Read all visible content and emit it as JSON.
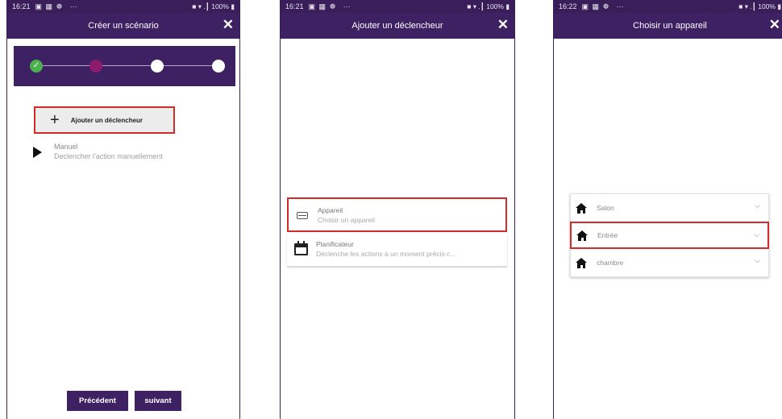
{
  "status_bar": {
    "icons": "▣ ▦ ☸",
    "dots": "···",
    "right": "■ ▾ .┃ 100% ▮",
    "times": [
      "16:21",
      "16:21",
      "16:22"
    ]
  },
  "panel1": {
    "title": "Créer un scénario",
    "close": "✕",
    "steps_done_mark": "✓",
    "add_trigger_label": "Ajouter un déclencheur",
    "add_trigger_plus": "+",
    "manual_title": "Manuel",
    "manual_subtitle": "Declencher l'action manuellement",
    "btn_prev": "Précédent",
    "btn_next": "suivant"
  },
  "panel2": {
    "title": "Ajouter un déclencheur",
    "close": "✕",
    "options": [
      {
        "title": "Appareil",
        "subtitle": "Choisir un appareil"
      },
      {
        "title": "Planificateur",
        "subtitle": "Déclenche les actions à un moment précis c..."
      }
    ]
  },
  "panel3": {
    "title": "Choisir un appareil",
    "close": "✕",
    "rooms": [
      "Salon",
      "Entrée",
      "chambre"
    ],
    "chevron": "⌵"
  },
  "colors": {
    "header": "#3e2163",
    "highlight": "#d42a2a",
    "step_done": "#4caf50",
    "step_active": "#8c1b6c"
  }
}
